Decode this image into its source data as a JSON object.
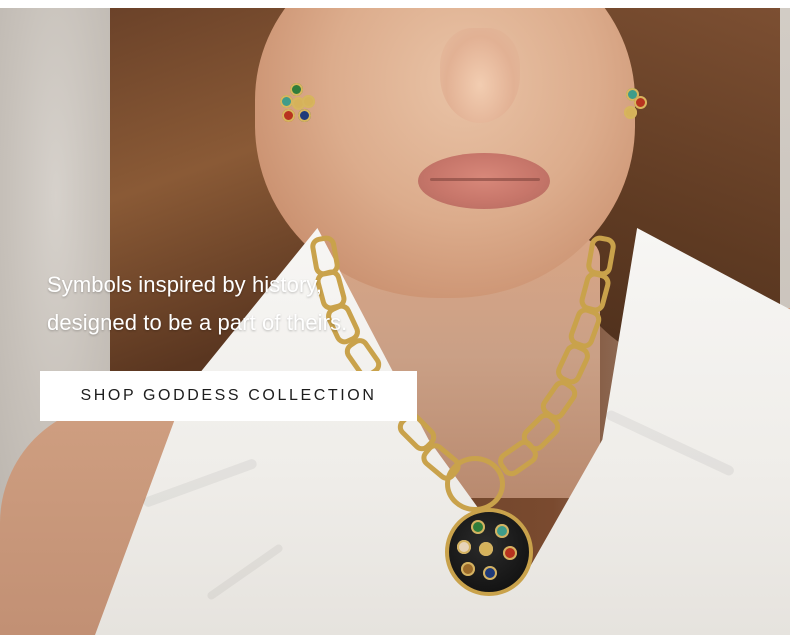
{
  "hero": {
    "headline_line1": "Symbols inspired by history,",
    "headline_line2": "designed to be a part of theirs.",
    "cta_label": "SHOP GODDESS COLLECTION"
  },
  "colors": {
    "cta_background": "#ffffff",
    "cta_text": "#1d1d1d",
    "headline_text": "#ffffff",
    "gold": "#c9a24b"
  }
}
